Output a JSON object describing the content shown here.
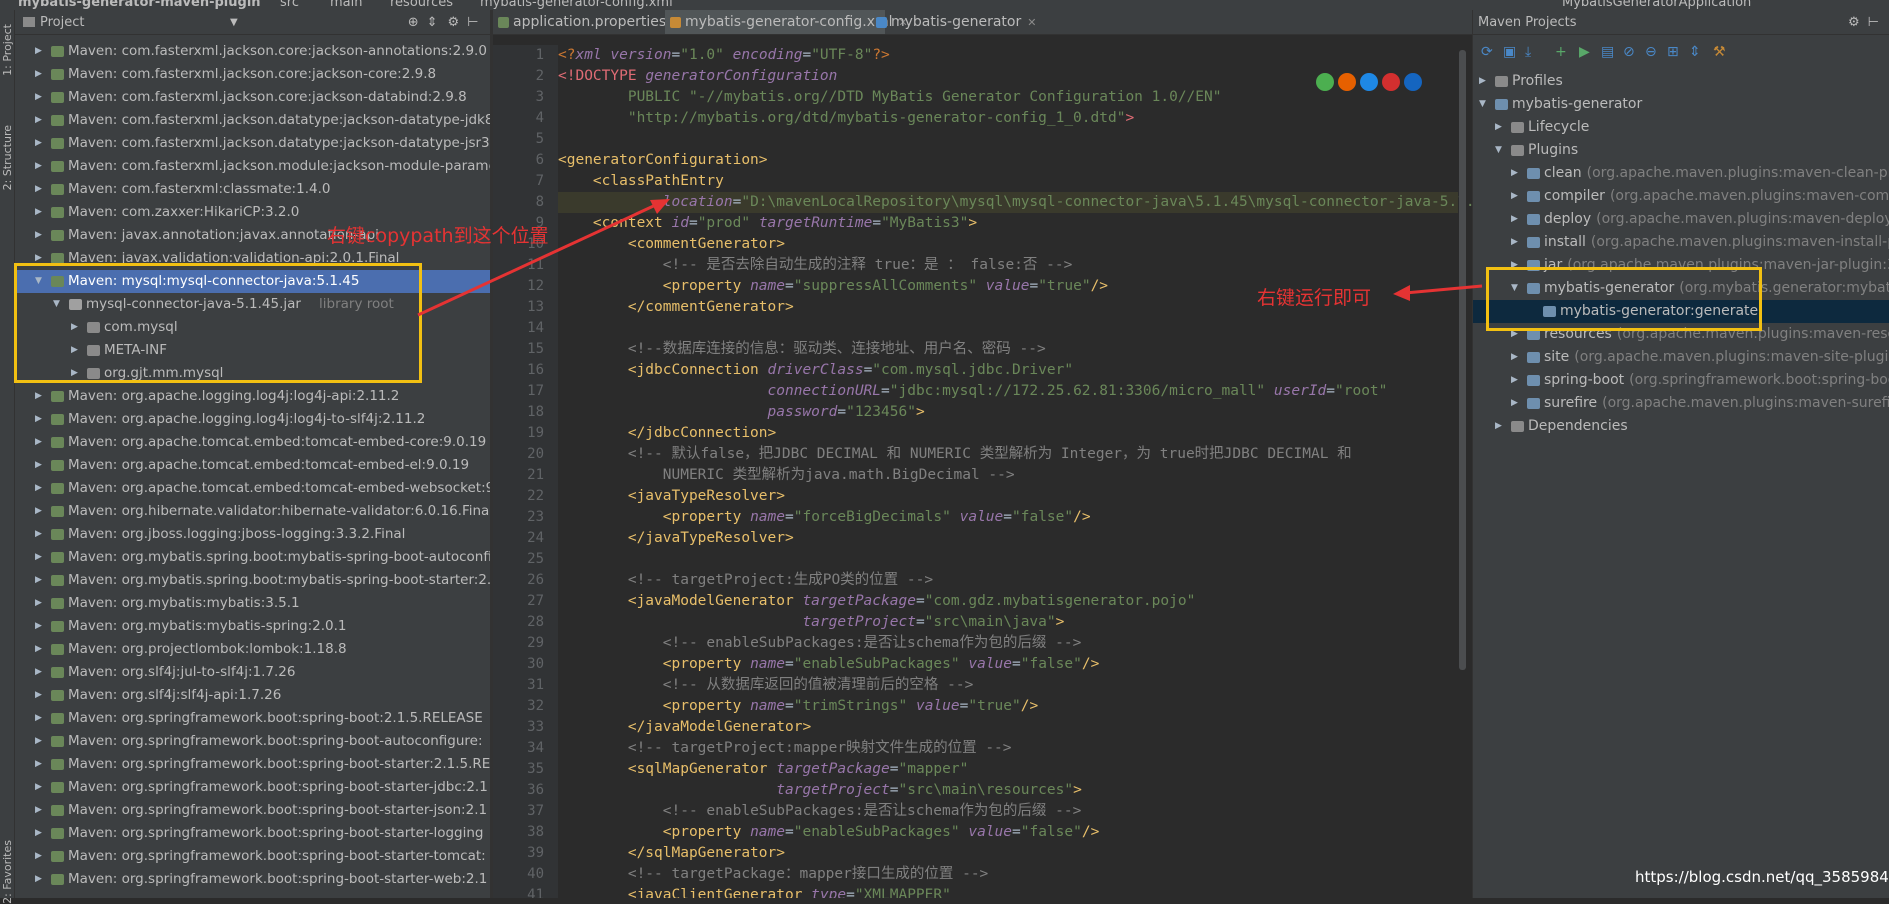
{
  "breadcrumb": [
    "mybatis-generator-maven-plugin",
    "src",
    "main",
    "resources",
    "mybatis-generator-config.xml"
  ],
  "toolbar": {
    "run_config": "MybatisGeneratorApplication"
  },
  "left_strip": {
    "project": "1: Project",
    "structure": "2: Structure",
    "favorites": "2: Favorites"
  },
  "project_panel": {
    "title": "Project",
    "items": [
      "Maven: com.fasterxml.jackson.core:jackson-annotations:2.9.0",
      "Maven: com.fasterxml.jackson.core:jackson-core:2.9.8",
      "Maven: com.fasterxml.jackson.core:jackson-databind:2.9.8",
      "Maven: com.fasterxml.jackson.datatype:jackson-datatype-jdk8",
      "Maven: com.fasterxml.jackson.datatype:jackson-datatype-jsr310",
      "Maven: com.fasterxml.jackson.module:jackson-module-parameter",
      "Maven: com.fasterxml:classmate:1.4.0",
      "Maven: com.zaxxer:HikariCP:3.2.0",
      "Maven: javax.annotation:javax.annotation-api",
      "Maven: javax.validation:validation-api:2.0.1.Final",
      "Maven: mysql:mysql-connector-java:5.1.45",
      "mysql-connector-java-5.1.45.jar",
      "com.mysql",
      "META-INF",
      "org.gjt.mm.mysql",
      "Maven: org.apache.logging.log4j:log4j-api:2.11.2",
      "Maven: org.apache.logging.log4j:log4j-to-slf4j:2.11.2",
      "Maven: org.apache.tomcat.embed:tomcat-embed-core:9.0.19",
      "Maven: org.apache.tomcat.embed:tomcat-embed-el:9.0.19",
      "Maven: org.apache.tomcat.embed:tomcat-embed-websocket:9",
      "Maven: org.hibernate.validator:hibernate-validator:6.0.16.Final",
      "Maven: org.jboss.logging:jboss-logging:3.3.2.Final",
      "Maven: org.mybatis.spring.boot:mybatis-spring-boot-autoconfigure",
      "Maven: org.mybatis.spring.boot:mybatis-spring-boot-starter:2.0",
      "Maven: org.mybatis:mybatis:3.5.1",
      "Maven: org.mybatis:mybatis-spring:2.0.1",
      "Maven: org.projectlombok:lombok:1.18.8",
      "Maven: org.slf4j:jul-to-slf4j:1.7.26",
      "Maven: org.slf4j:slf4j-api:1.7.26",
      "Maven: org.springframework.boot:spring-boot:2.1.5.RELEASE",
      "Maven: org.springframework.boot:spring-boot-autoconfigure:",
      "Maven: org.springframework.boot:spring-boot-starter:2.1.5.REL",
      "Maven: org.springframework.boot:spring-boot-starter-jdbc:2.1",
      "Maven: org.springframework.boot:spring-boot-starter-json:2.1",
      "Maven: org.springframework.boot:spring-boot-starter-logging",
      "Maven: org.springframework.boot:spring-boot-starter-tomcat:",
      "Maven: org.springframework.boot:spring-boot-starter-web:2.1"
    ],
    "library_root_label": "library root"
  },
  "editor": {
    "tabs": [
      "application.properties",
      "mybatis-generator-config.xml",
      "mybatis-generator"
    ],
    "line_numbers": [
      "1",
      "2",
      "3",
      "4",
      "5",
      "6",
      "7",
      "8",
      "9",
      "10",
      "11",
      "12",
      "13",
      "14",
      "15",
      "16",
      "17",
      "18",
      "19",
      "20",
      "21",
      "22",
      "23",
      "24",
      "25",
      "26",
      "27",
      "28",
      "29",
      "30",
      "31",
      "32",
      "33",
      "34",
      "35",
      "36",
      "37",
      "38",
      "39",
      "40",
      "41"
    ]
  },
  "maven_panel": {
    "title": "Maven Projects",
    "items": [
      {
        "label": "Profiles",
        "detail": ""
      },
      {
        "label": "mybatis-generator",
        "detail": ""
      },
      {
        "label": "Lifecycle",
        "detail": ""
      },
      {
        "label": "Plugins",
        "detail": ""
      },
      {
        "label": "clean",
        "detail": "(org.apache.maven.plugins:maven-clean-plugin"
      },
      {
        "label": "compiler",
        "detail": "(org.apache.maven.plugins:maven-compiler"
      },
      {
        "label": "deploy",
        "detail": "(org.apache.maven.plugins:maven-deploy"
      },
      {
        "label": "install",
        "detail": "(org.apache.maven.plugins:maven-install-plugin"
      },
      {
        "label": "jar",
        "detail": "(org.apache.maven.plugins:maven-jar-plugin:3"
      },
      {
        "label": "mybatis-generator",
        "detail": "(org.mybatis.generator:mybatis"
      },
      {
        "label": "mybatis-generator:generate",
        "detail": ""
      },
      {
        "label": "resources",
        "detail": "(org.apache.maven.plugins:maven-resources"
      },
      {
        "label": "site",
        "detail": "(org.apache.maven.plugins:maven-site-plugin"
      },
      {
        "label": "spring-boot",
        "detail": "(org.springframework.boot:spring-boot"
      },
      {
        "label": "surefire",
        "detail": "(org.apache.maven.plugins:maven-surefire"
      },
      {
        "label": "Dependencies",
        "detail": ""
      }
    ]
  },
  "annotations": {
    "left_note": "右键copypath到这个位置",
    "right_note": "右键运行即可",
    "arrow_color": "#e53333",
    "box_color": "#f2c012"
  },
  "watermark": "https://blog.csdn.net/qq_35859844",
  "colors": {
    "selection": "#4b6eaf",
    "editor_bg": "#2b2b2b",
    "panel_bg": "#3c3f41",
    "tag": "#e8bf6a",
    "attr": "#9876aa",
    "string": "#6a8759",
    "comment": "#808080"
  }
}
